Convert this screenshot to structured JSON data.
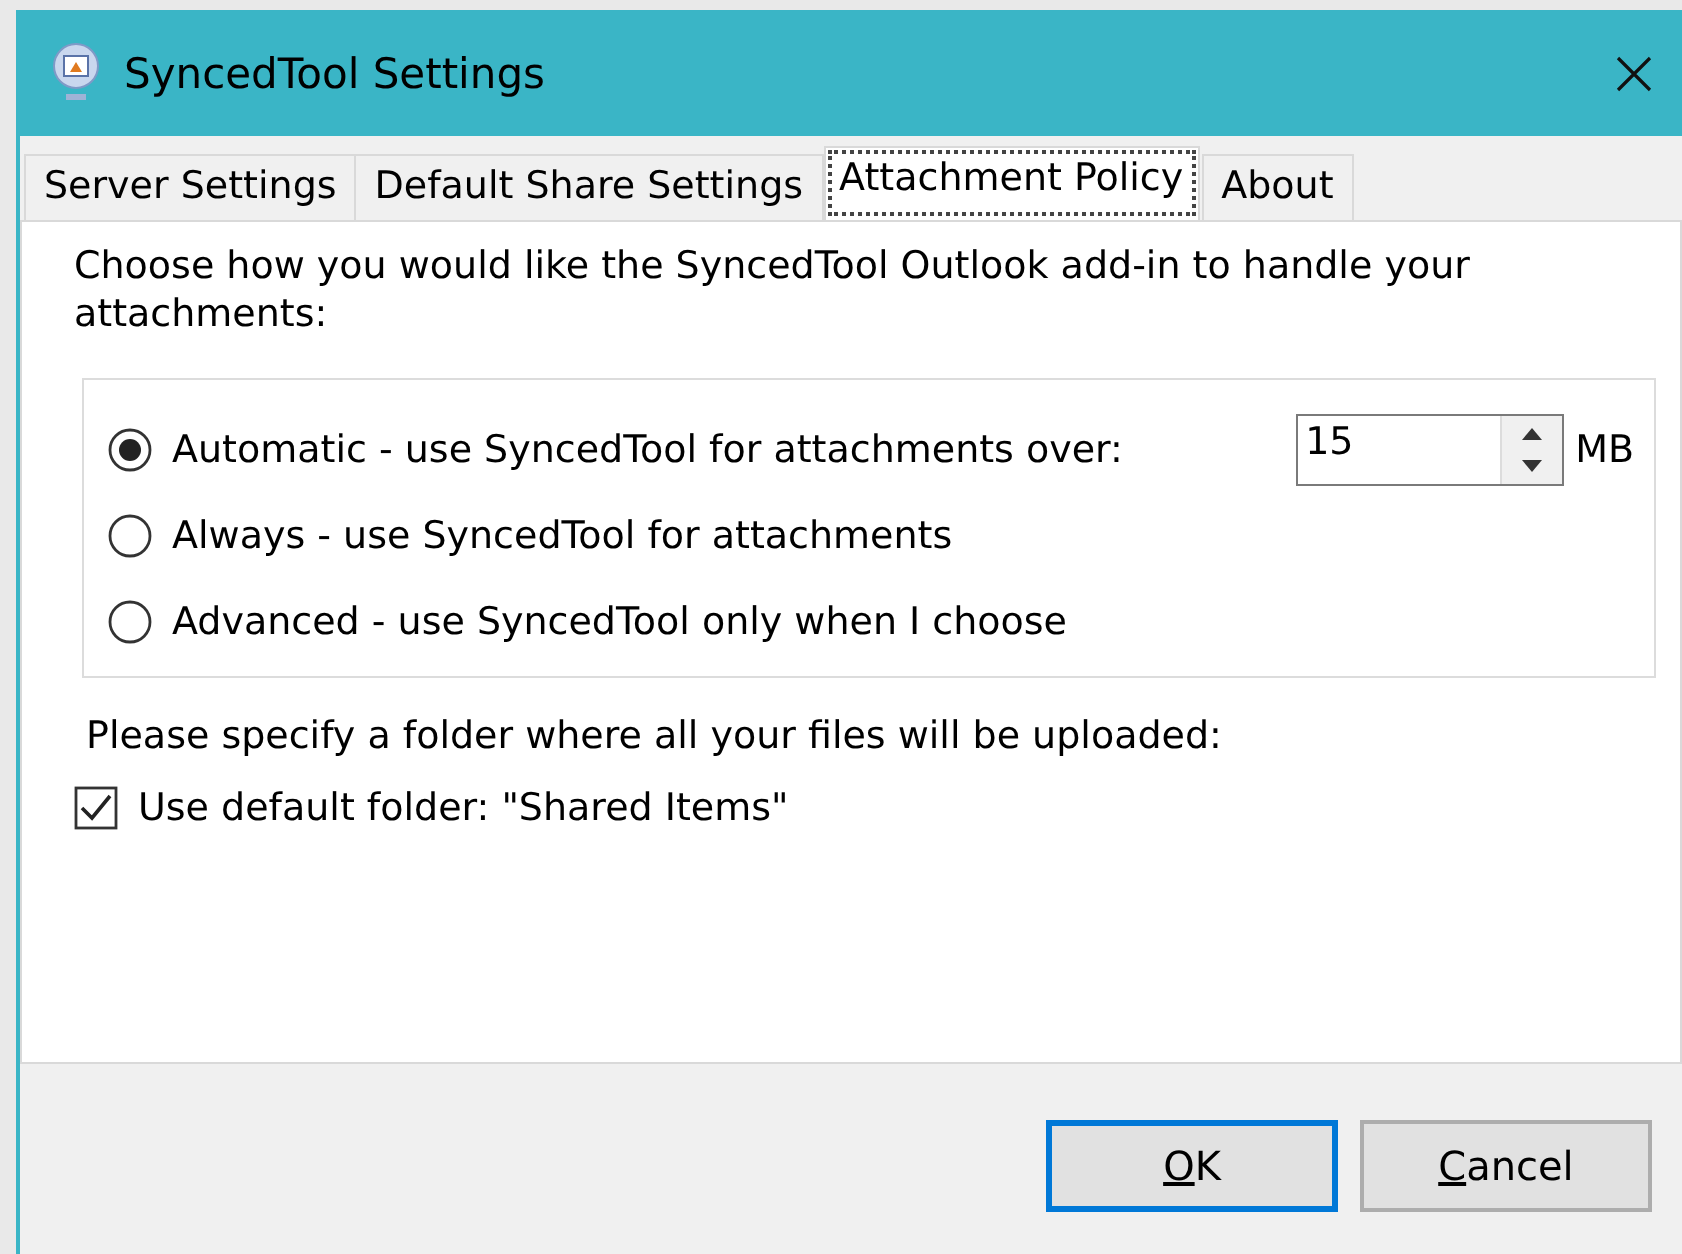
{
  "window": {
    "title": "SyncedTool Settings"
  },
  "tabs": [
    {
      "label": "Server Settings",
      "selected": false
    },
    {
      "label": "Default Share Settings",
      "selected": false
    },
    {
      "label": "Attachment Policy",
      "selected": true
    },
    {
      "label": "About",
      "selected": false
    }
  ],
  "intro": "Choose how you would like the SyncedTool Outlook add-in to handle your attachments:",
  "policy_options": [
    {
      "label": "Automatic - use SyncedTool for attachments over:",
      "selected": true
    },
    {
      "label": "Always - use SyncedTool for attachments",
      "selected": false
    },
    {
      "label": "Advanced - use SyncedTool only when I choose",
      "selected": false
    }
  ],
  "size_limit": {
    "value": "15",
    "unit": "MB"
  },
  "folder_prompt": "Please specify a folder where all your files will be uploaded:",
  "default_folder": {
    "label": "Use default folder: \"Shared Items\"",
    "checked": true
  },
  "buttons": [
    {
      "mnemonic": "O",
      "rest": "K",
      "default": true
    },
    {
      "mnemonic": "C",
      "rest": "ancel",
      "default": false
    }
  ]
}
